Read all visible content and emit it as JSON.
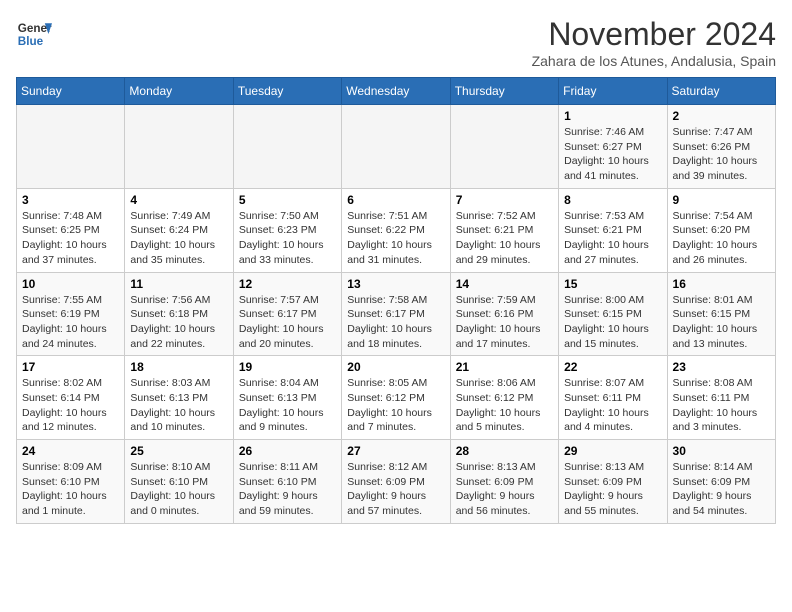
{
  "header": {
    "logo_line1": "General",
    "logo_line2": "Blue",
    "month": "November 2024",
    "location": "Zahara de los Atunes, Andalusia, Spain"
  },
  "days_of_week": [
    "Sunday",
    "Monday",
    "Tuesday",
    "Wednesday",
    "Thursday",
    "Friday",
    "Saturday"
  ],
  "weeks": [
    [
      {
        "day": "",
        "info": ""
      },
      {
        "day": "",
        "info": ""
      },
      {
        "day": "",
        "info": ""
      },
      {
        "day": "",
        "info": ""
      },
      {
        "day": "",
        "info": ""
      },
      {
        "day": "1",
        "info": "Sunrise: 7:46 AM\nSunset: 6:27 PM\nDaylight: 10 hours and 41 minutes."
      },
      {
        "day": "2",
        "info": "Sunrise: 7:47 AM\nSunset: 6:26 PM\nDaylight: 10 hours and 39 minutes."
      }
    ],
    [
      {
        "day": "3",
        "info": "Sunrise: 7:48 AM\nSunset: 6:25 PM\nDaylight: 10 hours and 37 minutes."
      },
      {
        "day": "4",
        "info": "Sunrise: 7:49 AM\nSunset: 6:24 PM\nDaylight: 10 hours and 35 minutes."
      },
      {
        "day": "5",
        "info": "Sunrise: 7:50 AM\nSunset: 6:23 PM\nDaylight: 10 hours and 33 minutes."
      },
      {
        "day": "6",
        "info": "Sunrise: 7:51 AM\nSunset: 6:22 PM\nDaylight: 10 hours and 31 minutes."
      },
      {
        "day": "7",
        "info": "Sunrise: 7:52 AM\nSunset: 6:21 PM\nDaylight: 10 hours and 29 minutes."
      },
      {
        "day": "8",
        "info": "Sunrise: 7:53 AM\nSunset: 6:21 PM\nDaylight: 10 hours and 27 minutes."
      },
      {
        "day": "9",
        "info": "Sunrise: 7:54 AM\nSunset: 6:20 PM\nDaylight: 10 hours and 26 minutes."
      }
    ],
    [
      {
        "day": "10",
        "info": "Sunrise: 7:55 AM\nSunset: 6:19 PM\nDaylight: 10 hours and 24 minutes."
      },
      {
        "day": "11",
        "info": "Sunrise: 7:56 AM\nSunset: 6:18 PM\nDaylight: 10 hours and 22 minutes."
      },
      {
        "day": "12",
        "info": "Sunrise: 7:57 AM\nSunset: 6:17 PM\nDaylight: 10 hours and 20 minutes."
      },
      {
        "day": "13",
        "info": "Sunrise: 7:58 AM\nSunset: 6:17 PM\nDaylight: 10 hours and 18 minutes."
      },
      {
        "day": "14",
        "info": "Sunrise: 7:59 AM\nSunset: 6:16 PM\nDaylight: 10 hours and 17 minutes."
      },
      {
        "day": "15",
        "info": "Sunrise: 8:00 AM\nSunset: 6:15 PM\nDaylight: 10 hours and 15 minutes."
      },
      {
        "day": "16",
        "info": "Sunrise: 8:01 AM\nSunset: 6:15 PM\nDaylight: 10 hours and 13 minutes."
      }
    ],
    [
      {
        "day": "17",
        "info": "Sunrise: 8:02 AM\nSunset: 6:14 PM\nDaylight: 10 hours and 12 minutes."
      },
      {
        "day": "18",
        "info": "Sunrise: 8:03 AM\nSunset: 6:13 PM\nDaylight: 10 hours and 10 minutes."
      },
      {
        "day": "19",
        "info": "Sunrise: 8:04 AM\nSunset: 6:13 PM\nDaylight: 10 hours and 9 minutes."
      },
      {
        "day": "20",
        "info": "Sunrise: 8:05 AM\nSunset: 6:12 PM\nDaylight: 10 hours and 7 minutes."
      },
      {
        "day": "21",
        "info": "Sunrise: 8:06 AM\nSunset: 6:12 PM\nDaylight: 10 hours and 5 minutes."
      },
      {
        "day": "22",
        "info": "Sunrise: 8:07 AM\nSunset: 6:11 PM\nDaylight: 10 hours and 4 minutes."
      },
      {
        "day": "23",
        "info": "Sunrise: 8:08 AM\nSunset: 6:11 PM\nDaylight: 10 hours and 3 minutes."
      }
    ],
    [
      {
        "day": "24",
        "info": "Sunrise: 8:09 AM\nSunset: 6:10 PM\nDaylight: 10 hours and 1 minute."
      },
      {
        "day": "25",
        "info": "Sunrise: 8:10 AM\nSunset: 6:10 PM\nDaylight: 10 hours and 0 minutes."
      },
      {
        "day": "26",
        "info": "Sunrise: 8:11 AM\nSunset: 6:10 PM\nDaylight: 9 hours and 59 minutes."
      },
      {
        "day": "27",
        "info": "Sunrise: 8:12 AM\nSunset: 6:09 PM\nDaylight: 9 hours and 57 minutes."
      },
      {
        "day": "28",
        "info": "Sunrise: 8:13 AM\nSunset: 6:09 PM\nDaylight: 9 hours and 56 minutes."
      },
      {
        "day": "29",
        "info": "Sunrise: 8:13 AM\nSunset: 6:09 PM\nDaylight: 9 hours and 55 minutes."
      },
      {
        "day": "30",
        "info": "Sunrise: 8:14 AM\nSunset: 6:09 PM\nDaylight: 9 hours and 54 minutes."
      }
    ]
  ]
}
